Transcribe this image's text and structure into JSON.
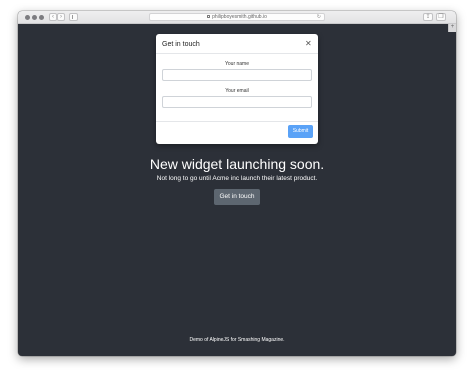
{
  "browser": {
    "url": "philipboyesmith.github.io",
    "back_glyph": "‹",
    "forward_glyph": "›",
    "reload_glyph": "↻",
    "share_glyph": "⇪",
    "tabs_glyph": "❐",
    "newtab_glyph": "+"
  },
  "modal": {
    "title": "Get in touch",
    "close_glyph": "✕",
    "name_label": "Your name",
    "name_value": "",
    "email_label": "Your email",
    "email_value": "",
    "submit_label": "Submit"
  },
  "hero": {
    "headline": "New widget launching soon.",
    "subline": "Not long to go until Acme inc launch their latest product.",
    "cta_label": "Get in touch"
  },
  "footer": {
    "text": "Demo of AlpineJS for Smashing Magazine."
  },
  "colors": {
    "page_background": "#2c3038",
    "submit_button": "#5aa2f7",
    "cta_button": "#5d6670"
  }
}
